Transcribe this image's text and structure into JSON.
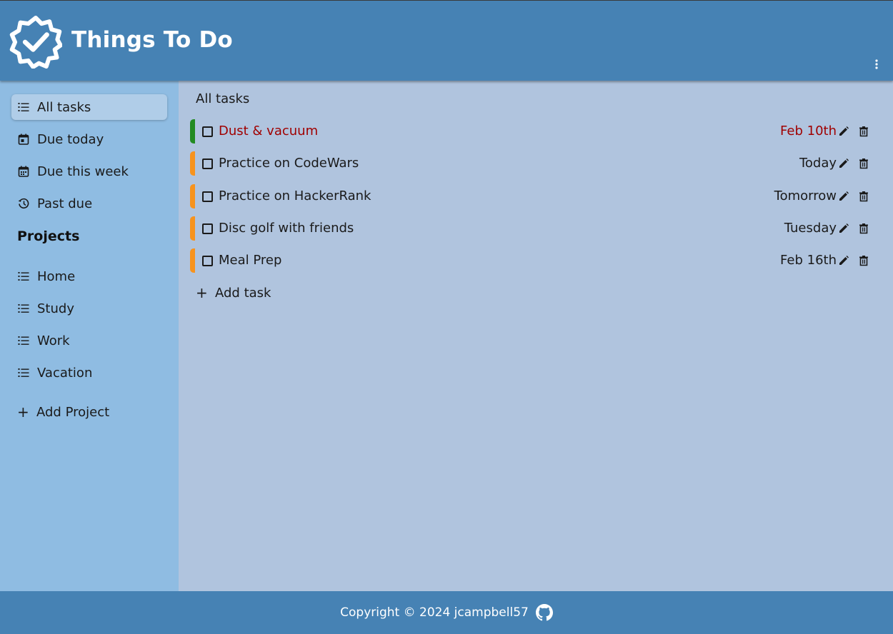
{
  "header": {
    "title": "Things To Do",
    "logo_icon": "verified-badge-icon",
    "menu_icon": "more-vertical-icon"
  },
  "sidebar": {
    "items": [
      {
        "label": "All tasks",
        "icon": "list-icon",
        "active": true
      },
      {
        "label": "Due today",
        "icon": "calendar-today-icon"
      },
      {
        "label": "Due this week",
        "icon": "calendar-week-icon"
      },
      {
        "label": "Past due",
        "icon": "history-icon"
      }
    ],
    "projects_heading": "Projects",
    "projects": [
      {
        "label": "Home",
        "icon": "list-icon"
      },
      {
        "label": "Study",
        "icon": "list-icon"
      },
      {
        "label": "Work",
        "icon": "list-icon"
      },
      {
        "label": "Vacation",
        "icon": "list-icon"
      }
    ],
    "add_project_label": "Add Project"
  },
  "main": {
    "title": "All tasks",
    "tasks": [
      {
        "name": "Dust & vacuum",
        "due": "Feb 10th",
        "overdue": true,
        "priority_color": "#228b22"
      },
      {
        "name": "Practice on CodeWars",
        "due": "Today",
        "overdue": false,
        "priority_color": "#f7931e"
      },
      {
        "name": "Practice on HackerRank",
        "due": "Tomorrow",
        "overdue": false,
        "priority_color": "#f7931e"
      },
      {
        "name": "Disc golf with friends",
        "due": "Tuesday",
        "overdue": false,
        "priority_color": "#f7931e"
      },
      {
        "name": "Meal Prep",
        "due": "Feb 16th",
        "overdue": false,
        "priority_color": "#f7931e"
      }
    ],
    "add_task_label": "Add task"
  },
  "footer": {
    "copyright": "Copyright © 2024 jcampbell57",
    "github_icon": "github-icon"
  },
  "colors": {
    "header_bg": "#4682b4",
    "sidebar_bg": "#8fbce2",
    "main_bg": "#b0c4de",
    "overdue_text": "#a00000"
  }
}
